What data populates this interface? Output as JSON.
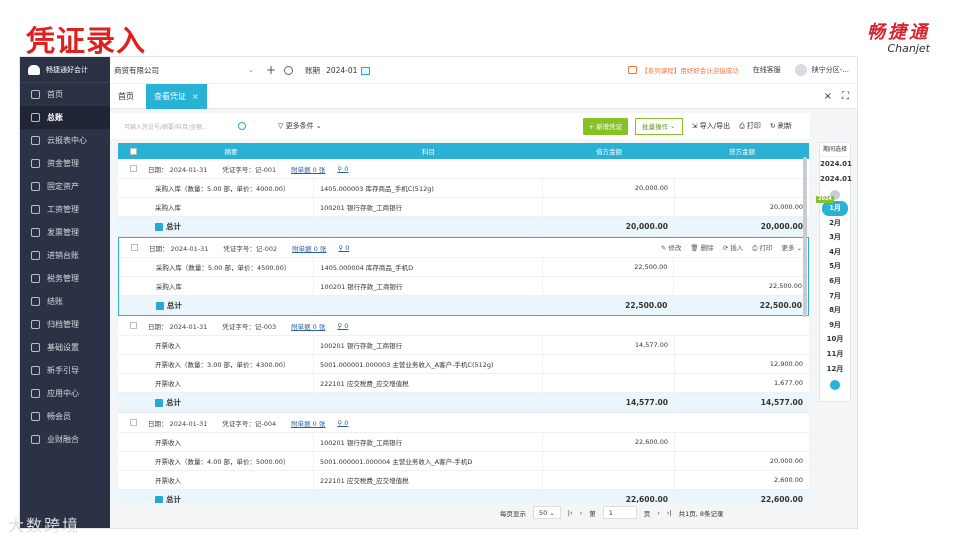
{
  "slide": {
    "title": "凭证录入",
    "brand_cn": "畅捷通",
    "brand_en": "Chanjet",
    "watermark": "大数跨境"
  },
  "sidebar": {
    "logo": "畅捷通好会计",
    "items": [
      {
        "label": "首页",
        "icon": "home-icon"
      },
      {
        "label": "总账",
        "icon": "ledger-icon",
        "active": true
      },
      {
        "label": "云报表中心",
        "icon": "report-icon"
      },
      {
        "label": "资金管理",
        "icon": "money-icon"
      },
      {
        "label": "固定资产",
        "icon": "asset-icon"
      },
      {
        "label": "工资管理",
        "icon": "salary-icon"
      },
      {
        "label": "发票管理",
        "icon": "invoice-icon"
      },
      {
        "label": "进销台账",
        "icon": "inventory-icon"
      },
      {
        "label": "税务管理",
        "icon": "tax-icon"
      },
      {
        "label": "结账",
        "icon": "close-account-icon"
      },
      {
        "label": "归档管理",
        "icon": "archive-icon"
      },
      {
        "label": "基础设置",
        "icon": "settings-icon"
      },
      {
        "label": "新手引导",
        "icon": "guide-icon"
      },
      {
        "label": "应用中心",
        "icon": "apps-icon"
      },
      {
        "label": "畅会员",
        "icon": "member-icon"
      },
      {
        "label": "业财融合",
        "icon": "integration-icon"
      }
    ]
  },
  "topbar": {
    "company": "商贸有限公司",
    "period_label": "账期",
    "period": "2024-01",
    "notice": "【系列课程】用好好会计迎接成功",
    "service": "在线客服",
    "user": "陕宁分区-..."
  },
  "tabs": [
    {
      "label": "首页"
    },
    {
      "label": "查看凭证",
      "active": true
    }
  ],
  "filter": {
    "placeholder": "可输入凭证号/摘要/科目/金额...",
    "more": "更多条件",
    "add": "+ 新增凭证",
    "batch": "批量操作",
    "import": "导入/导出",
    "print": "打印",
    "refresh": "刷新"
  },
  "grid": {
    "headers": [
      "摘要",
      "科目",
      "借方金额",
      "贷方金额"
    ],
    "meta_labels": {
      "date": "日期：",
      "no": "凭证字号：",
      "attach": "附单据",
      "attach_unit": "张",
      "total": "总计"
    },
    "op_labels": {
      "edit": "修改",
      "delete": "删除",
      "insert": "插入",
      "print": "打印",
      "more": "更多"
    },
    "vouchers": [
      {
        "date": "2024-01-31",
        "no": "记-001",
        "attach": "0",
        "clip": "0",
        "rows": [
          {
            "summary": "采购入库（数量：5.00 部，单价：4000.00）",
            "account": "1405.000003 库存商品_手机C(512g)",
            "debit": "20,000.00",
            "credit": ""
          },
          {
            "summary": "采购入库",
            "account": "100201 银行存款_工商银行",
            "debit": "",
            "credit": "20,000.00"
          }
        ],
        "total_debit": "20,000.00",
        "total_credit": "20,000.00"
      },
      {
        "date": "2024-01-31",
        "no": "记-002",
        "attach": "0",
        "clip": "0",
        "selected": true,
        "rows": [
          {
            "summary": "采购入库（数量：5.00 部，单价：4500.00）",
            "account": "1405.000004 库存商品_手机D",
            "debit": "22,500.00",
            "credit": ""
          },
          {
            "summary": "采购入库",
            "account": "100201 银行存款_工商银行",
            "debit": "",
            "credit": "22,500.00"
          }
        ],
        "total_debit": "22,500.00",
        "total_credit": "22,500.00"
      },
      {
        "date": "2024-01-31",
        "no": "记-003",
        "attach": "0",
        "clip": "0",
        "rows": [
          {
            "summary": "开票收入",
            "account": "100201 银行存款_工商银行",
            "debit": "14,577.00",
            "credit": ""
          },
          {
            "summary": "开票收入（数量：3.00 部，单价：4300.00）",
            "account": "5001.000001.000003 主营业务收入_A客户-手机C(512g)",
            "debit": "",
            "credit": "12,900.00"
          },
          {
            "summary": "开票收入",
            "account": "222101 应交税费_应交增值税",
            "debit": "",
            "credit": "1,677.00"
          }
        ],
        "total_debit": "14,577.00",
        "total_credit": "14,577.00"
      },
      {
        "date": "2024-01-31",
        "no": "记-004",
        "attach": "0",
        "clip": "0",
        "rows": [
          {
            "summary": "开票收入",
            "account": "100201 银行存款_工商银行",
            "debit": "22,600.00",
            "credit": ""
          },
          {
            "summary": "开票收入（数量：4.00 部，单价：5000.00）",
            "account": "5001.000001.000004 主营业务收入_A客户-手机D",
            "debit": "",
            "credit": "20,000.00"
          },
          {
            "summary": "开票收入",
            "account": "222101 应交税费_应交增值税",
            "debit": "",
            "credit": "2,600.00"
          }
        ],
        "total_debit": "22,600.00",
        "total_credit": "22,600.00"
      }
    ]
  },
  "pager": {
    "per_page_label": "每页显示",
    "per_page": "50",
    "page_label": "第",
    "page": "1",
    "page_unit": "页",
    "summary": "共1页, 8条记录"
  },
  "period_panel": {
    "title": "期间选择",
    "from": "2024.01",
    "to": "2024.01",
    "badge": "2024",
    "months": [
      "1月",
      "2月",
      "3月",
      "4月",
      "5月",
      "6月",
      "7月",
      "8月",
      "9月",
      "10月",
      "11月",
      "12月"
    ]
  }
}
